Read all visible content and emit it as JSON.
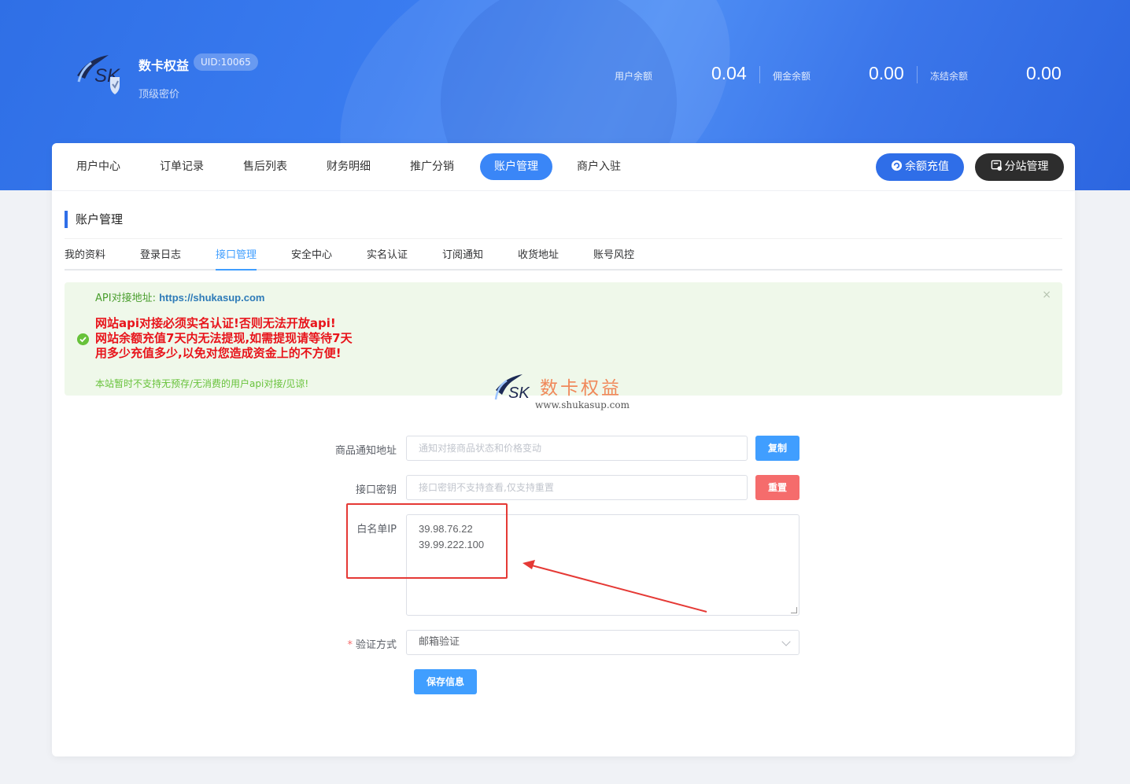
{
  "header": {
    "brand_name": "数卡权益",
    "uid": "UID:10065",
    "subtitle": "顶级密价",
    "balances": [
      {
        "label": "用户余额",
        "value": "0.04"
      },
      {
        "label": "佣金余额",
        "value": "0.00"
      },
      {
        "label": "冻结余额",
        "value": "0.00"
      }
    ]
  },
  "nav": {
    "items": [
      "用户中心",
      "订单记录",
      "售后列表",
      "财务明细",
      "推广分销",
      "账户管理",
      "商户入驻"
    ],
    "active": "账户管理",
    "recharge_label": "余额充值",
    "substation_label": "分站管理"
  },
  "section": {
    "title": "账户管理",
    "tabs": [
      "我的资料",
      "登录日志",
      "接口管理",
      "安全中心",
      "实名认证",
      "订阅通知",
      "收货地址",
      "账号风控"
    ],
    "active_tab": "接口管理"
  },
  "alert": {
    "api_label": "API对接地址:",
    "api_url": "https://shukasup.com",
    "warn_line1": "网站api对接必须实名认证!否则无法开放api!",
    "warn_line2": "网站余额充值7天内无法提现,如需提现请等待7天",
    "warn_line3": "用多少充值多少,以免对您造成资金上的不方便!",
    "note": "本站暂时不支持无预存/无消费的用户api对接/见谅!",
    "close": "×"
  },
  "watermark": {
    "logo_text": "SK",
    "cn": "数卡权益",
    "url": "www.shukasup.com"
  },
  "form": {
    "notify_label": "商品通知地址",
    "notify_placeholder": "通知对接商品状态和价格变动",
    "copy_label": "复制",
    "key_label": "接口密钥",
    "key_placeholder": "接口密钥不支持查看,仅支持重置",
    "reset_label": "重置",
    "whitelist_label": "白名单IP",
    "whitelist_ips": [
      "39.98.76.22",
      "39.99.222.100"
    ],
    "verify_label": "验证方式",
    "verify_value": "邮箱验证",
    "save_label": "保存信息"
  },
  "colors": {
    "primary": "#409eff",
    "nav_active": "#3a86f7",
    "danger": "#f56c6c",
    "warn_text": "#e8141b",
    "success": "#67c23a"
  }
}
